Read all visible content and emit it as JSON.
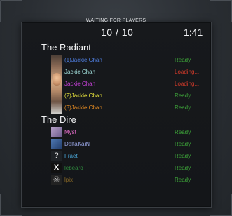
{
  "header": {
    "title": "WAITING FOR PLAYERS",
    "count": "10 / 10",
    "timer": "1:41"
  },
  "colors": {
    "ready": "#3ea83a",
    "loading": "#d23a2a"
  },
  "teams": [
    {
      "name": "The Radiant",
      "players": [
        {
          "name": "(1)Jackie Chan",
          "status": "Ready",
          "name_color": "#4f7ee0",
          "status_color": "#3ea83a",
          "icon": "jackie-chan-avatar-icon"
        },
        {
          "name": "Jackie Chan",
          "status": "Loading...",
          "name_color": "#9fdcd8",
          "status_color": "#d23a2a",
          "icon": "jackie-chan-avatar-icon"
        },
        {
          "name": "Jackie Chan",
          "status": "Loading...",
          "name_color": "#c23fd4",
          "status_color": "#d23a2a",
          "icon": "jackie-chan-avatar-icon"
        },
        {
          "name": "(2)Jackie Chan",
          "status": "Ready",
          "name_color": "#e8e33c",
          "status_color": "#3ea83a",
          "icon": "jackie-chan-avatar-icon"
        },
        {
          "name": "(3)Jackie Chan",
          "status": "Ready",
          "name_color": "#e38a22",
          "status_color": "#3ea83a",
          "icon": "jackie-chan-avatar-icon"
        }
      ]
    },
    {
      "name": "The Dire",
      "players": [
        {
          "name": "Myst",
          "status": "Ready",
          "name_color": "#e06cc7",
          "status_color": "#3ea83a",
          "icon": "myst-avatar-icon"
        },
        {
          "name": "DeltaKaiN",
          "status": "Ready",
          "name_color": "#9aa7e6",
          "status_color": "#3ea83a",
          "icon": "deltakain-avatar-icon"
        },
        {
          "name": "Fraet",
          "status": "Ready",
          "name_color": "#4aa7d8",
          "status_color": "#3ea83a",
          "icon": "question-mark-avatar-icon"
        },
        {
          "name": "lebearo",
          "status": "Ready",
          "name_color": "#2e8a3e",
          "status_color": "#3ea83a",
          "icon": "x-avatar-icon"
        },
        {
          "name": "lpix",
          "status": "Ready",
          "name_color": "#8c6a26",
          "status_color": "#3ea83a",
          "icon": "skull-avatar-icon"
        }
      ]
    }
  ]
}
